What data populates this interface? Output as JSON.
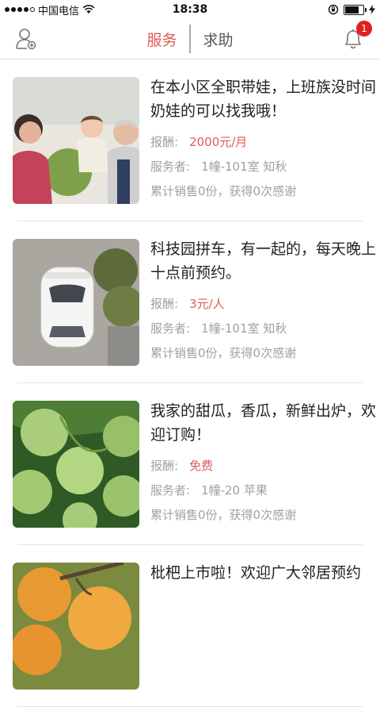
{
  "status": {
    "carrier": "中国电信",
    "time": "18:38"
  },
  "header": {
    "tabs": [
      "服务",
      "求助"
    ],
    "notification_count": "1"
  },
  "labels": {
    "reward": "报酬:",
    "provider": "服务者:"
  },
  "items": [
    {
      "title": "在本小区全职带娃，上班族没时间奶娃的可以找我哦！",
      "price": "2000元/月",
      "provider": "1幢-101室 知秋",
      "sales": "累计销售0份，获得0次感谢"
    },
    {
      "title": "科技园拼车，有一起的，每天晚上十点前预约。",
      "price": "3元/人",
      "provider": "1幢-101室 知秋",
      "sales": "累计销售0份，获得0次感谢"
    },
    {
      "title": "我家的甜瓜，香瓜，新鲜出炉，欢迎订购！",
      "price": "免费",
      "provider": "1幢-20 苹果",
      "sales": "累计销售0份，获得0次感谢"
    },
    {
      "title": "枇杷上市啦！欢迎广大邻居预约",
      "price": "",
      "provider": "",
      "sales": ""
    }
  ]
}
